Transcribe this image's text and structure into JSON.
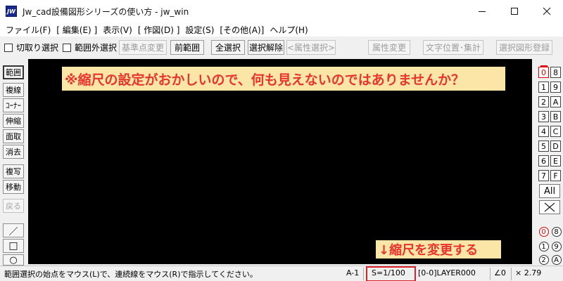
{
  "window": {
    "title": "Jw_cad設備図形シリーズの使い方 - jw_win",
    "app_icon_text": "JW"
  },
  "menu": {
    "items": [
      "ファイル(F)",
      "[ 編集(E) ]",
      "表示(V)",
      "[ 作図(D) ]",
      "設定(S)",
      "[その他(A)]",
      "ヘルプ(H)"
    ]
  },
  "toolbar": {
    "chk_cut_select": "切取り選択",
    "chk_outside_select": "範囲外選択",
    "btn_base_point": "基準点変更",
    "btn_prev_range": "前範囲",
    "btn_select_all": "全選択",
    "btn_deselect": "選択解除",
    "btn_attr_select": "<属性選択>",
    "btn_attr_change": "属性変更",
    "btn_text_pos": "文字位置･集計",
    "btn_register": "選択図形登録"
  },
  "left_tools": {
    "range": "範囲",
    "copy_line": "複線",
    "corner": "ｺｰﾅｰ",
    "stretch": "伸縮",
    "chamfer": "面取",
    "erase": "消去",
    "copy": "複写",
    "move": "移動",
    "back": "戻る",
    "line": "／",
    "rect": "□",
    "circle": "○"
  },
  "right_layers": {
    "groups_a": [
      "0",
      "1",
      "2",
      "3",
      "4",
      "5",
      "6",
      "7"
    ],
    "groups_b": [
      "8",
      "9",
      "A",
      "B",
      "C",
      "D",
      "E",
      "F"
    ],
    "all": "All",
    "cross": "✕",
    "circ_a": [
      "0",
      "1",
      "2"
    ],
    "circ_b": [
      "8",
      "9",
      "A"
    ]
  },
  "annotations": {
    "top_message": "※縮尺の設定がおかしいので、何も見えないのではありませんか？",
    "bottom_message": "↓縮尺を変更する"
  },
  "status": {
    "message": "範囲選択の始点をマウス(L)で、連続線をマウス(R)で指示してください。",
    "paper": "A-1",
    "scale": "S=1/100",
    "layer": "[0-0]LAYER000",
    "angle": "∠0",
    "multiplier": "× 2.79"
  },
  "colors": {
    "canvas": "#000000",
    "annotation_bg": "#fbe6a8",
    "annotation_text": "#e8342b",
    "highlight_box": "#d8232a"
  }
}
